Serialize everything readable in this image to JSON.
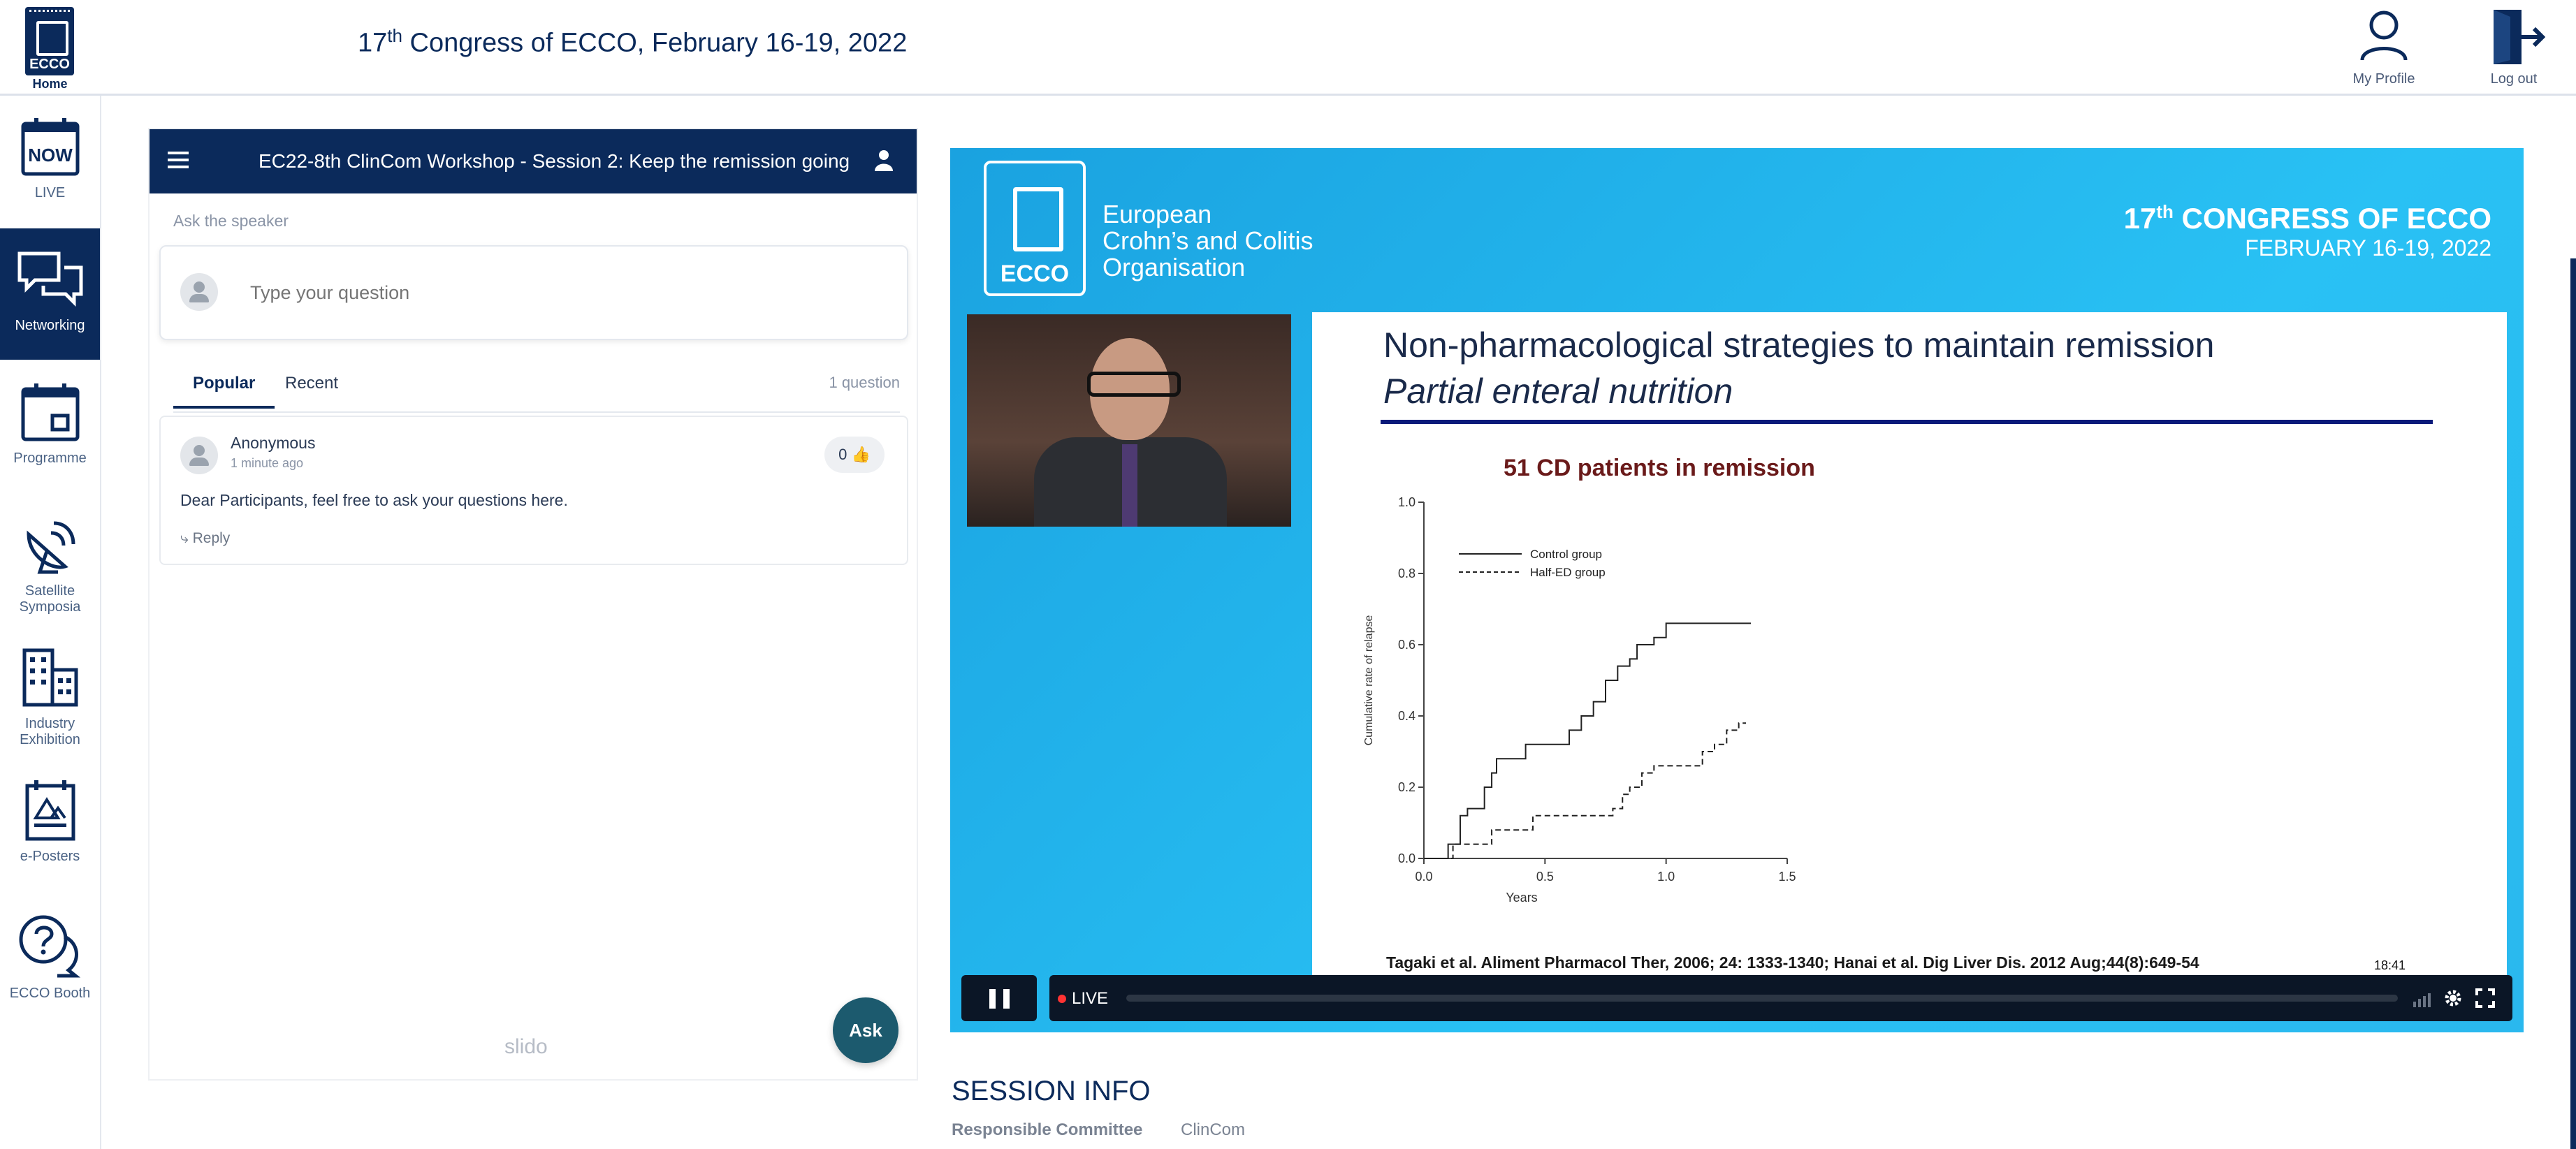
{
  "app": {
    "brand_text": "ECCO",
    "home_label": "Home",
    "title_prefix": "17",
    "title_sup": "th",
    "title_suffix": " Congress of ECCO, February 16-19, 2022"
  },
  "header_actions": {
    "profile_label": "My Profile",
    "logout_label": "Log out"
  },
  "sidebar": {
    "items": [
      {
        "id": "live",
        "label": "LIVE",
        "icon": "now-calendar-icon",
        "icon_text": "NOW",
        "active": false
      },
      {
        "id": "networking",
        "label": "Networking",
        "icon": "chat-bubbles-icon",
        "active": true
      },
      {
        "id": "programme",
        "label": "Programme",
        "icon": "calendar-icon",
        "active": false
      },
      {
        "id": "satellite",
        "label": "Satellite Symposia",
        "icon": "satellite-dish-icon",
        "active": false
      },
      {
        "id": "industry",
        "label": "Industry Exhibition",
        "icon": "buildings-icon",
        "active": false
      },
      {
        "id": "eposters",
        "label": "e-Posters",
        "icon": "poster-icon",
        "active": false
      },
      {
        "id": "booth",
        "label": "ECCO Booth",
        "icon": "help-bubbles-icon",
        "active": false
      }
    ]
  },
  "qa": {
    "session_title": "EC22-8th ClinCom Workshop - Session 2: Keep the remission going",
    "ask_label": "Ask the speaker",
    "input_placeholder": "Type your question",
    "tabs": [
      {
        "label": "Popular",
        "active": true
      },
      {
        "label": "Recent",
        "active": false
      }
    ],
    "question_count": "1 question",
    "questions": [
      {
        "author": "Anonymous",
        "time": "1 minute ago",
        "likes": "0",
        "text": "Dear Participants, feel free to ask your questions here.",
        "reply_label": "Reply"
      }
    ],
    "powered_by": "slido",
    "ask_button": "Ask"
  },
  "video": {
    "org_line1": "European",
    "org_line2": "Crohn’s and Colitis",
    "org_line3": "Organisation",
    "logo_text": "ECCO",
    "congress_prefix": "17",
    "congress_sup": "th",
    "congress_suffix": " CONGRESS OF ECCO",
    "congress_dates": "FEBRUARY 16-19, 2022",
    "slide_title": "Non-pharmacological strategies to maintain remission",
    "slide_subtitle": "Partial enteral nutrition",
    "chart_heading": "51 CD patients in remission",
    "citation": "Tagaki et al. Aliment Pharmacol Ther, 2006; 24: 1333-1340;  Hanai et al. Dig Liver Dis. 2012 Aug;44(8):649-54",
    "live_label": "LIVE",
    "time_bubble": "18:41"
  },
  "chart_data": {
    "type": "line",
    "title": "51 CD patients in remission",
    "xlabel": "Years",
    "ylabel": "Cumulative rate of relapse",
    "xlim": [
      0,
      1.5
    ],
    "ylim": [
      0,
      1.0
    ],
    "x_ticks": [
      "0.0",
      "0.5",
      "1.0",
      "1.5"
    ],
    "y_ticks": [
      "0.0",
      "0.2",
      "0.4",
      "0.6",
      "0.8",
      "1.0"
    ],
    "grid": false,
    "legend_position": "top-left",
    "series": [
      {
        "name": "Control group",
        "style": "solid",
        "x": [
          0,
          0.1,
          0.1,
          0.15,
          0.15,
          0.18,
          0.18,
          0.25,
          0.25,
          0.28,
          0.28,
          0.3,
          0.3,
          0.42,
          0.42,
          0.6,
          0.6,
          0.65,
          0.65,
          0.7,
          0.7,
          0.75,
          0.75,
          0.8,
          0.8,
          0.85,
          0.85,
          0.88,
          0.88,
          0.95,
          0.95,
          1.0,
          1.0,
          1.35
        ],
        "y": [
          0,
          0,
          0.04,
          0.04,
          0.12,
          0.12,
          0.14,
          0.14,
          0.2,
          0.2,
          0.24,
          0.24,
          0.28,
          0.28,
          0.32,
          0.32,
          0.36,
          0.36,
          0.4,
          0.4,
          0.44,
          0.44,
          0.5,
          0.5,
          0.54,
          0.54,
          0.56,
          0.56,
          0.6,
          0.6,
          0.62,
          0.62,
          0.66,
          0.66
        ]
      },
      {
        "name": "Half-ED group",
        "style": "dashed",
        "x": [
          0,
          0.12,
          0.12,
          0.28,
          0.28,
          0.45,
          0.45,
          0.6,
          0.6,
          0.78,
          0.78,
          0.82,
          0.82,
          0.85,
          0.85,
          0.9,
          0.9,
          0.95,
          0.95,
          1.0,
          1.0,
          1.15,
          1.15,
          1.2,
          1.2,
          1.25,
          1.25,
          1.3,
          1.3,
          1.33
        ],
        "y": [
          0,
          0,
          0.04,
          0.04,
          0.08,
          0.08,
          0.12,
          0.12,
          0.12,
          0.12,
          0.14,
          0.14,
          0.18,
          0.18,
          0.2,
          0.2,
          0.24,
          0.24,
          0.26,
          0.26,
          0.26,
          0.26,
          0.3,
          0.3,
          0.32,
          0.32,
          0.36,
          0.36,
          0.38,
          0.38
        ]
      }
    ]
  },
  "session_info": {
    "heading": "SESSION INFO",
    "committee_label": "Responsible Committee",
    "committee_value": "ClinCom"
  },
  "colors": {
    "brand_navy": "#0b2a5b",
    "video_blue": "#29c1f4",
    "ask_button": "#1c5a6e"
  }
}
